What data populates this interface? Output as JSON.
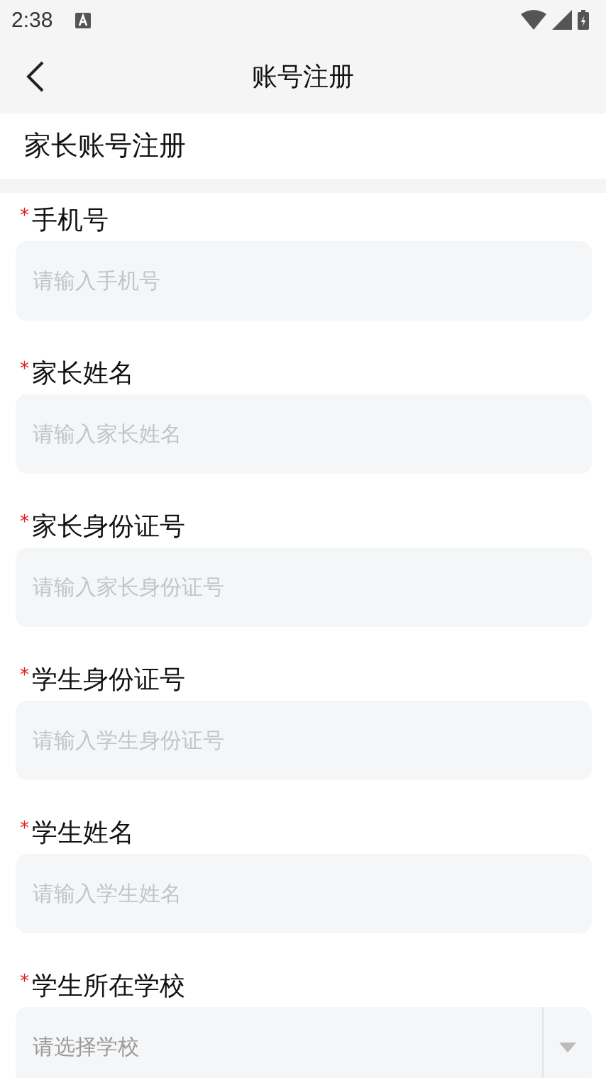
{
  "status_bar": {
    "time": "2:38"
  },
  "header": {
    "title": "账号注册"
  },
  "section": {
    "title": "家长账号注册"
  },
  "fields": [
    {
      "kind": "input",
      "required_mark": "*",
      "label": "手机号",
      "placeholder": "请输入手机号"
    },
    {
      "kind": "input",
      "required_mark": "*",
      "label": "家长姓名",
      "placeholder": "请输入家长姓名"
    },
    {
      "kind": "input",
      "required_mark": "*",
      "label": "家长身份证号",
      "placeholder": "请输入家长身份证号"
    },
    {
      "kind": "input",
      "required_mark": "*",
      "label": "学生身份证号",
      "placeholder": "请输入学生身份证号"
    },
    {
      "kind": "input",
      "required_mark": "*",
      "label": "学生姓名",
      "placeholder": "请输入学生姓名"
    },
    {
      "kind": "select",
      "required_mark": "*",
      "label": "学生所在学校",
      "placeholder": "请选择学校"
    }
  ]
}
